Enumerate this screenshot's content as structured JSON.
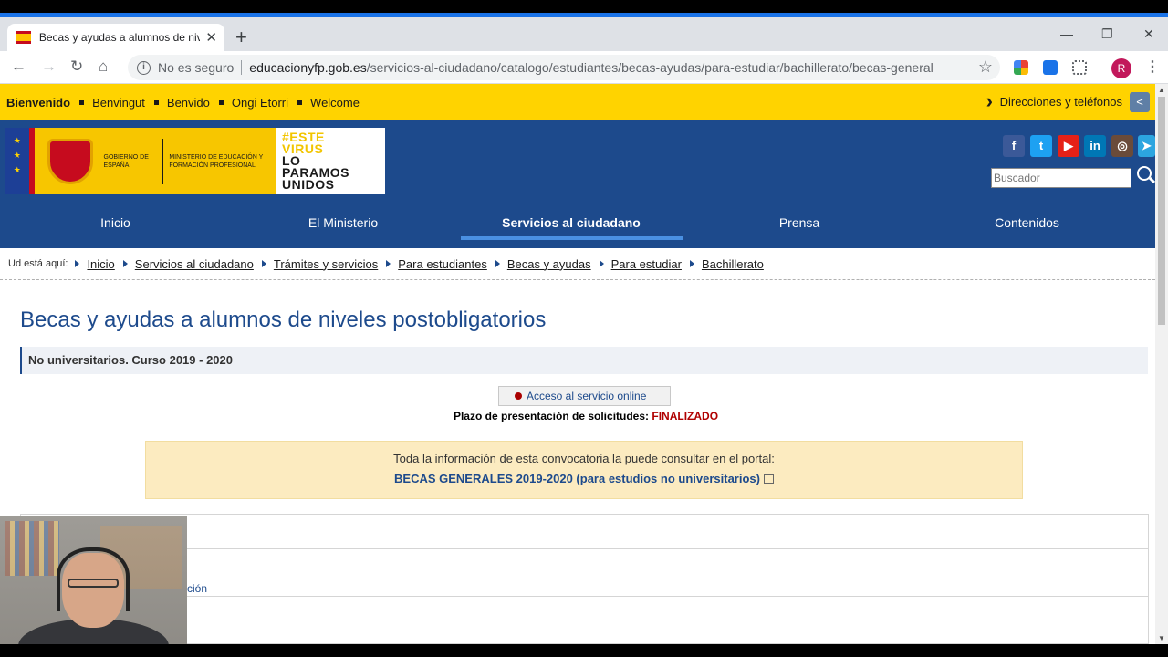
{
  "browser": {
    "tab_title": "Becas y ayudas a alumnos de niv",
    "tab_close": "✕",
    "new_tab": "+",
    "security_label": "No es seguro",
    "url_domain": "educacionyfp.gob.es",
    "url_path": "/servicios-al-ciudadano/catalogo/estudiantes/becas-ayudas/para-estudiar/bachillerato/becas-generales...",
    "avatar_letter": "R"
  },
  "langbar": {
    "languages": [
      "Bienvenido",
      "Benvingut",
      "Benvido",
      "Ongi Etorri",
      "Welcome"
    ],
    "directions_link": "Direcciones y teléfonos"
  },
  "header": {
    "logo_gov_text": "GOBIERNO DE ESPAÑA",
    "logo_ministry_text": "MINISTERIO DE EDUCACIÓN Y FORMACIÓN PROFESIONAL",
    "campaign_line1": "#ESTE",
    "campaign_line2": "VIRUS",
    "campaign_line3": "LO",
    "campaign_line4": "PARAMOS",
    "campaign_line5": "UNIDOS",
    "search_placeholder": "Buscador",
    "social": [
      {
        "name": "facebook-icon",
        "glyph": "f",
        "color": "#3b5998"
      },
      {
        "name": "twitter-icon",
        "glyph": "t",
        "color": "#1da1f2"
      },
      {
        "name": "youtube-icon",
        "glyph": "▶",
        "color": "#e62117"
      },
      {
        "name": "linkedin-icon",
        "glyph": "in",
        "color": "#0077b5"
      },
      {
        "name": "instagram-icon",
        "glyph": "◎",
        "color": "#6a4b3a"
      },
      {
        "name": "telegram-icon",
        "glyph": "➤",
        "color": "#2ca5e0"
      }
    ]
  },
  "nav": {
    "items": [
      "Inicio",
      "El Ministerio",
      "Servicios al ciudadano",
      "Prensa",
      "Contenidos"
    ]
  },
  "breadcrumb": {
    "label": "Ud está aquí:",
    "items": [
      "Inicio",
      "Servicios al ciudadano",
      "Trámites y servicios",
      "Para estudiantes",
      "Becas y ayudas",
      "Para estudiar",
      "Bachillerato"
    ]
  },
  "content": {
    "title": "Becas y ayudas a alumnos de niveles postobligatorios",
    "subtitle": "No universitarios. Curso 2019 - 2020",
    "access_button": "Acceso al servicio online",
    "deadline_label": "Plazo de presentación de solicitudes:",
    "deadline_status": "FINALIZADO",
    "info_text": "Toda la información de esta convocatoria la puede consultar en el portal:",
    "info_link": "BECAS GENERALES 2019-2020 (para estudios no universitarios)",
    "partial_row_text": "ción"
  },
  "colors": {
    "yellow_bar": "#ffd300",
    "header_blue": "#1d4a8c",
    "status_red": "#b00000"
  }
}
